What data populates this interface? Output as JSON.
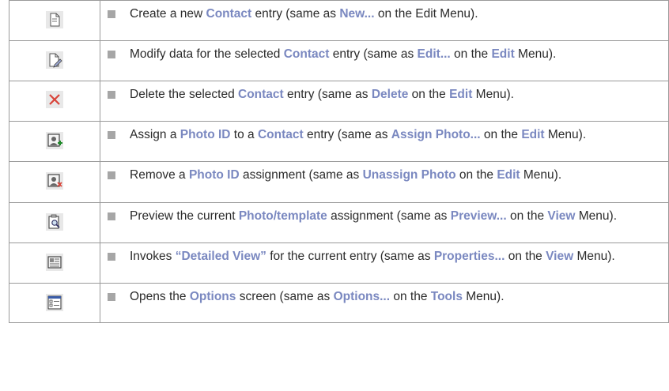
{
  "colors": {
    "highlight": "#7a88c0",
    "text": "#2b2b2b",
    "bullet": "#a6a6a6",
    "border": "#9a9a9a"
  },
  "rows": [
    {
      "icon": "new-document-icon",
      "parts": [
        {
          "t": "Create a new ",
          "b": false
        },
        {
          "t": "Contact",
          "b": true
        },
        {
          "t": " entry (same as ",
          "b": false
        },
        {
          "t": "New...",
          "b": true
        },
        {
          "t": " on the Edit Menu).",
          "b": false
        }
      ]
    },
    {
      "icon": "edit-document-icon",
      "parts": [
        {
          "t": "Modify data for the selected ",
          "b": false
        },
        {
          "t": "Contact",
          "b": true
        },
        {
          "t": " entry (same as ",
          "b": false
        },
        {
          "t": "Edit...",
          "b": true
        },
        {
          "t": " on the ",
          "b": false
        },
        {
          "t": "Edit",
          "b": true
        },
        {
          "t": " Menu).",
          "b": false
        }
      ]
    },
    {
      "icon": "delete-icon",
      "parts": [
        {
          "t": "Delete the selected ",
          "b": false
        },
        {
          "t": "Contact",
          "b": true
        },
        {
          "t": " entry (same as ",
          "b": false
        },
        {
          "t": "Delete",
          "b": true
        },
        {
          "t": " on the ",
          "b": false
        },
        {
          "t": "Edit",
          "b": true
        },
        {
          "t": " Menu).",
          "b": false
        }
      ]
    },
    {
      "icon": "assign-photo-icon",
      "parts": [
        {
          "t": "Assign a ",
          "b": false
        },
        {
          "t": "Photo ID",
          "b": true
        },
        {
          "t": " to a ",
          "b": false
        },
        {
          "t": "Contact",
          "b": true
        },
        {
          "t": " entry (same as ",
          "b": false
        },
        {
          "t": "Assign Photo...",
          "b": true
        },
        {
          "t": " on the ",
          "b": false
        },
        {
          "t": "Edit",
          "b": true
        },
        {
          "t": " Menu).",
          "b": false
        }
      ]
    },
    {
      "icon": "unassign-photo-icon",
      "parts": [
        {
          "t": "Remove a ",
          "b": false
        },
        {
          "t": "Photo ID",
          "b": true
        },
        {
          "t": " assignment (same as ",
          "b": false
        },
        {
          "t": "Unassign Photo",
          "b": true
        },
        {
          "t": " on the ",
          "b": false
        },
        {
          "t": "Edit",
          "b": true
        },
        {
          "t": " Menu).",
          "b": false
        }
      ]
    },
    {
      "icon": "preview-icon",
      "parts": [
        {
          "t": "Preview the current ",
          "b": false
        },
        {
          "t": "Photo/template",
          "b": true
        },
        {
          "t": " assignment (same as ",
          "b": false
        },
        {
          "t": "Preview...",
          "b": true
        },
        {
          "t": " on the ",
          "b": false
        },
        {
          "t": "View",
          "b": true
        },
        {
          "t": " Menu).",
          "b": false
        }
      ]
    },
    {
      "icon": "properties-icon",
      "parts": [
        {
          "t": "Invokes ",
          "b": false
        },
        {
          "t": "“Detailed View”",
          "b": true
        },
        {
          "t": " for the current entry (same as ",
          "b": false
        },
        {
          "t": "Properties...",
          "b": true
        },
        {
          "t": " on the ",
          "b": false
        },
        {
          "t": "View",
          "b": true
        },
        {
          "t": " Menu).",
          "b": false
        }
      ]
    },
    {
      "icon": "options-icon",
      "parts": [
        {
          "t": "Opens the ",
          "b": false
        },
        {
          "t": "Options",
          "b": true
        },
        {
          "t": " screen (same as ",
          "b": false
        },
        {
          "t": "Options...",
          "b": true
        },
        {
          "t": " on the ",
          "b": false
        },
        {
          "t": "Tools",
          "b": true
        },
        {
          "t": " Menu).",
          "b": false
        }
      ]
    }
  ]
}
